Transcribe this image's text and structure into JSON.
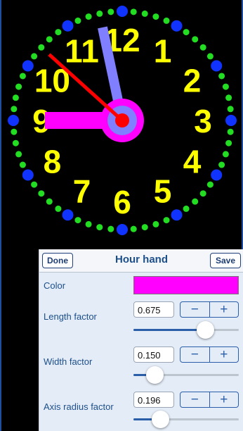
{
  "colors": {
    "background": "#000000",
    "ring_green": "#22dd22",
    "ring_blue": "#1133ff",
    "numerals": "#ffff00",
    "hour_hand": "#ff00ff",
    "minute_hand": "#7f7fff",
    "second_hand": "#ff0000",
    "center_dot": "#ff0000",
    "frame_blue": "#1f4f9e"
  },
  "clock": {
    "numerals": [
      "12",
      "1",
      "2",
      "3",
      "4",
      "5",
      "6",
      "7",
      "8",
      "9",
      "10",
      "11"
    ],
    "hour_value": 9.0,
    "minute_value": 58,
    "second_value": 52
  },
  "panel": {
    "title": "Hour hand",
    "done_label": "Done",
    "save_label": "Save",
    "color_label": "Color",
    "color_value": "#ff00ff",
    "rows": [
      {
        "label": "Length factor",
        "value": "0.675",
        "slider_fraction": 0.68
      },
      {
        "label": "Width factor",
        "value": "0.150",
        "slider_fraction": 0.2
      },
      {
        "label": "Axis radius factor",
        "value": "0.196",
        "slider_fraction": 0.25
      }
    ],
    "minus_symbol": "−",
    "plus_symbol": "+"
  }
}
